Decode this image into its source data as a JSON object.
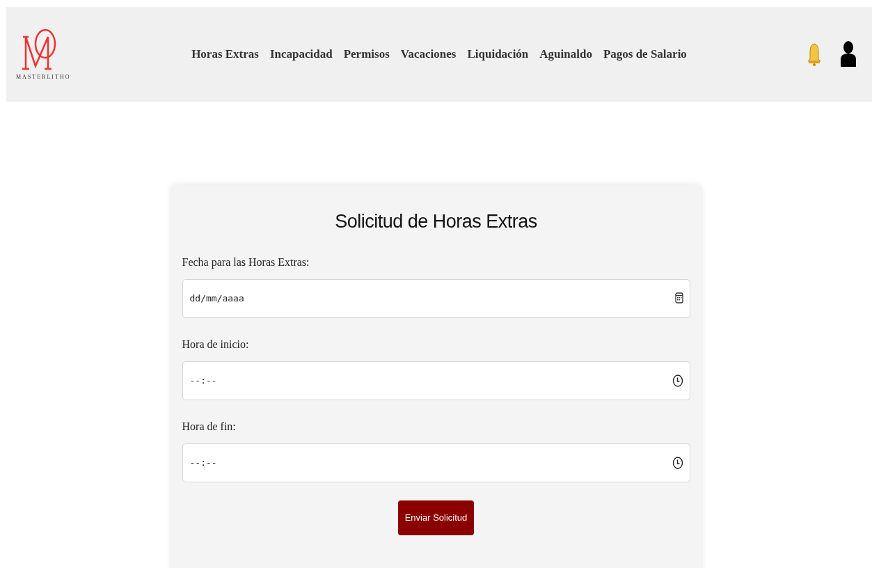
{
  "header": {
    "logo_text": "MASTERLITHO",
    "nav": [
      "Horas Extras",
      "Incapacidad",
      "Permisos",
      "Vacaciones",
      "Liquidación",
      "Aguinaldo",
      "Pagos de Salario"
    ]
  },
  "form": {
    "title": "Solicitud de Horas Extras",
    "fields": [
      {
        "label": "Fecha para las Horas Extras:",
        "kind": "date",
        "placeholder": "dd/mm/aaaa"
      },
      {
        "label": "Hora de inicio:",
        "kind": "time",
        "placeholder": "--:--"
      },
      {
        "label": "Hora de fin:",
        "kind": "time",
        "placeholder": "--:--"
      }
    ],
    "submit": "Enviar Solicitud"
  }
}
